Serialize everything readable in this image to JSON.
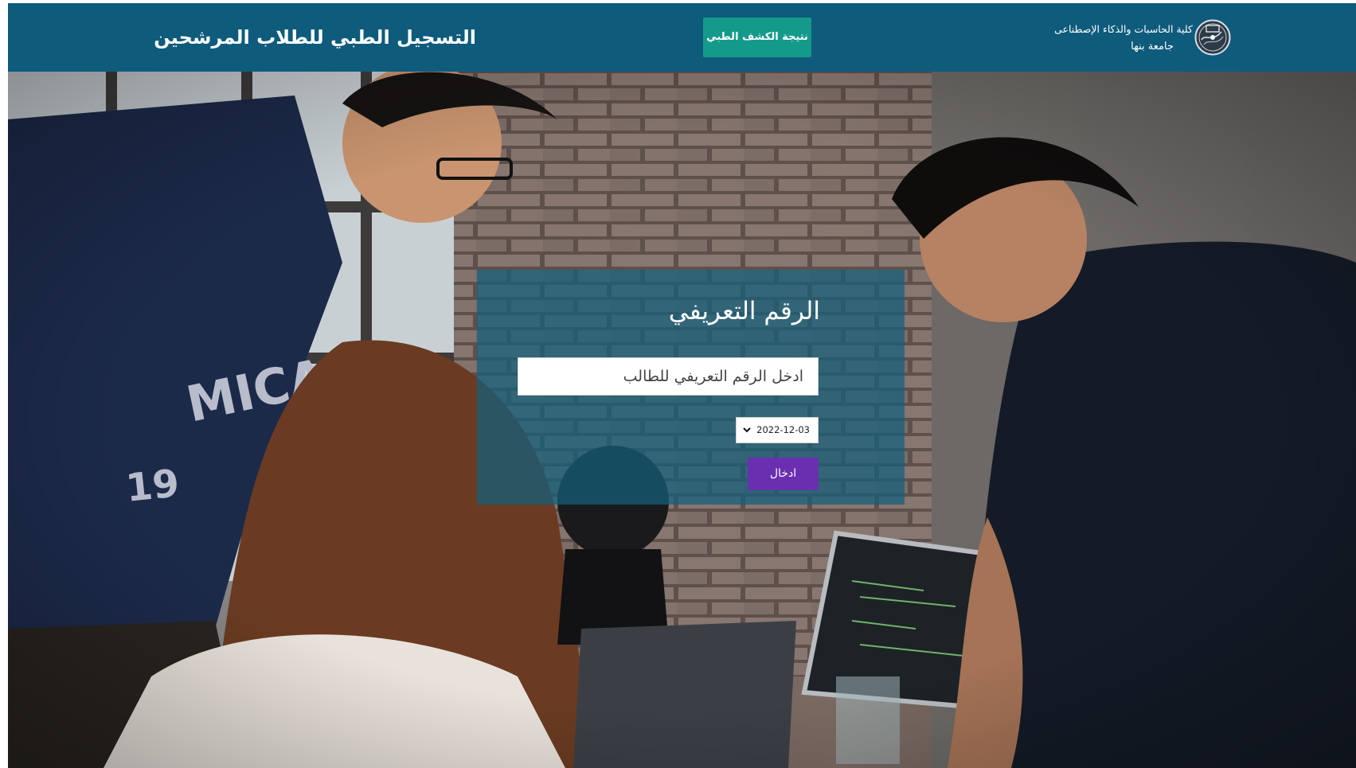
{
  "header": {
    "title": "التسجيل الطبي للطلاب المرشحين",
    "result_button": "نتيجة الكشف الطبي",
    "brand_line1": "كلية الحاسبات والذكاء الإصطناعى",
    "brand_line2": "جامعة بنها",
    "logo_icon": "university-seal-icon"
  },
  "form": {
    "heading": "الرقم التعريفي",
    "id_placeholder": "ادخل الرقم التعريفي للطالب",
    "id_value": "",
    "date_value": "2022-12-03",
    "submit_label": "ادخال"
  },
  "colors": {
    "header_bg": "#0e5b7c",
    "result_button_bg": "#149a8a",
    "panel_bg": "#14607c",
    "submit_bg": "#6a2fb0"
  }
}
